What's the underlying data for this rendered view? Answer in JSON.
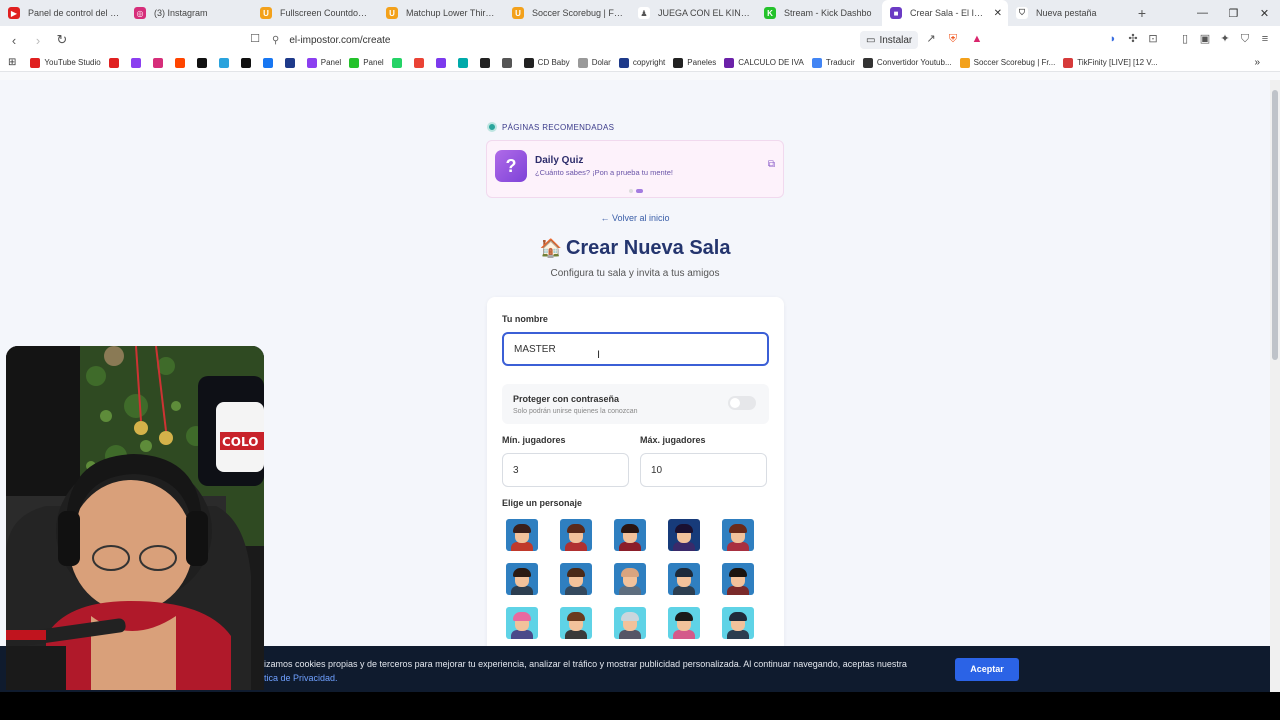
{
  "tabs": [
    {
      "title": "Panel de control del canal",
      "color": "#e02020",
      "glyph": "▶"
    },
    {
      "title": "(3) Instagram",
      "color": "#d62e7a",
      "glyph": "◎"
    },
    {
      "title": "Fullscreen Countdown | Ti",
      "color": "#f3a11b",
      "glyph": "U"
    },
    {
      "title": "Matchup Lower Third | Fre",
      "color": "#f3a11b",
      "glyph": "U"
    },
    {
      "title": "Soccer Scorebug | Fresh -",
      "color": "#f3a11b",
      "glyph": "U"
    },
    {
      "title": "JUEGA CON EL KING – el n",
      "color": "#ffffff",
      "glyph": "♟"
    },
    {
      "title": "Stream - Kick Dashbo",
      "color": "#24c22b",
      "glyph": "K"
    },
    {
      "title": "Crear Sala - El Impost",
      "color": "#6b3bc4",
      "glyph": "■"
    },
    {
      "title": "Nueva pestaña",
      "color": "#ffffff",
      "glyph": "⛉"
    }
  ],
  "url": "el-impostor.com/create",
  "install_label": "Instalar",
  "bookmarks": [
    {
      "label": "YouTube Studio",
      "color": "#e02020"
    },
    {
      "label": "",
      "color": "#e02020"
    },
    {
      "label": "",
      "color": "#8b3ff0"
    },
    {
      "label": "",
      "color": "#d62e7a"
    },
    {
      "label": "",
      "color": "#ff4500"
    },
    {
      "label": "",
      "color": "#111111"
    },
    {
      "label": "",
      "color": "#2aa3dd"
    },
    {
      "label": "",
      "color": "#111111"
    },
    {
      "label": "",
      "color": "#1877f2"
    },
    {
      "label": "",
      "color": "#1e3a8a"
    },
    {
      "label": "Panel",
      "color": "#8b3ff0"
    },
    {
      "label": "Panel",
      "color": "#24c22b"
    },
    {
      "label": "",
      "color": "#25d366"
    },
    {
      "label": "",
      "color": "#ea4335"
    },
    {
      "label": "",
      "color": "#7c3aed"
    },
    {
      "label": "",
      "color": "#0aa"
    },
    {
      "label": "",
      "color": "#222"
    },
    {
      "label": "",
      "color": "#555"
    },
    {
      "label": "CD Baby",
      "color": "#222"
    },
    {
      "label": "Dolar",
      "color": "#999"
    },
    {
      "label": "copyright",
      "color": "#1e3a8a"
    },
    {
      "label": "Paneles",
      "color": "#222"
    },
    {
      "label": "CALCULO DE IVA",
      "color": "#6b21a8"
    },
    {
      "label": "Traducir",
      "color": "#4285f4"
    },
    {
      "label": "Convertidor Youtub...",
      "color": "#333"
    },
    {
      "label": "Soccer Scorebug | Fr...",
      "color": "#f3a11b"
    },
    {
      "label": "TikFinity [LIVE] [12 V...",
      "color": "#d63a3a"
    }
  ],
  "recommended": {
    "heading": "PÁGINAS RECOMENDADAS",
    "card_title": "Daily Quiz",
    "card_subtitle": "¿Cuánto sabes? ¡Pon a prueba tu mente!",
    "icon_glyph": "?"
  },
  "back_link": "← Volver al inicio",
  "title_icon": "🏠",
  "title": "Crear Nueva Sala",
  "subtitle": "Configura tu sala y invita a tus amigos",
  "form": {
    "name_label": "Tu nombre",
    "name_value": "MASTER",
    "password_title": "Proteger con contraseña",
    "password_sub": "Solo podrán unirse quienes la conozcan",
    "password_enabled": false,
    "min_label": "Mín. jugadores",
    "min_value": "3",
    "max_label": "Máx. jugadores",
    "max_value": "10",
    "character_label": "Elige un personaje"
  },
  "avatars": [
    {
      "bg": "#2f7fc0",
      "hair": "#3a1f1a",
      "body": "#c0392b"
    },
    {
      "bg": "#2f7fc0",
      "hair": "#5a2a1a",
      "body": "#b03030"
    },
    {
      "bg": "#2f7fc0",
      "hair": "#2a1510",
      "body": "#8b1e2a"
    },
    {
      "bg": "#173b7a",
      "hair": "#1a1030",
      "body": "#3a2a6a"
    },
    {
      "bg": "#2f7fc0",
      "hair": "#6a2a1a",
      "body": "#a83040"
    },
    {
      "bg": "#2f7fc0",
      "hair": "#2b1a12",
      "body": "#2c3e50"
    },
    {
      "bg": "#2f7fc0",
      "hair": "#4a2a18",
      "body": "#34495e"
    },
    {
      "bg": "#2f7fc0",
      "hair": "#d9a47f",
      "body": "#5d6d7e"
    },
    {
      "bg": "#2f7fc0",
      "hair": "#1d2a3a",
      "body": "#2c3e50"
    },
    {
      "bg": "#2f7fc0",
      "hair": "#1a1410",
      "body": "#7a2a2a"
    },
    {
      "bg": "#5fd3e6",
      "hair": "#e86aa0",
      "body": "#4a4a8a"
    },
    {
      "bg": "#5fd3e6",
      "hair": "#6a3a1e",
      "body": "#3a3a3a"
    },
    {
      "bg": "#5fd3e6",
      "hair": "#c9d6dd",
      "body": "#556"
    },
    {
      "bg": "#5fd3e6",
      "hair": "#1a1a1a",
      "body": "#d45a8a"
    },
    {
      "bg": "#5fd3e6",
      "hair": "#202a3a",
      "body": "#2c3e50"
    }
  ],
  "cookie": {
    "text": "izamos cookies propias y de terceros para mejorar tu experiencia, analizar el tráfico y mostrar publicidad personalizada. Al continuar navegando, aceptas nuestra",
    "link": "tica de Privacidad.",
    "accept": "Aceptar"
  },
  "webcam": {
    "badge_text": "COLO"
  }
}
